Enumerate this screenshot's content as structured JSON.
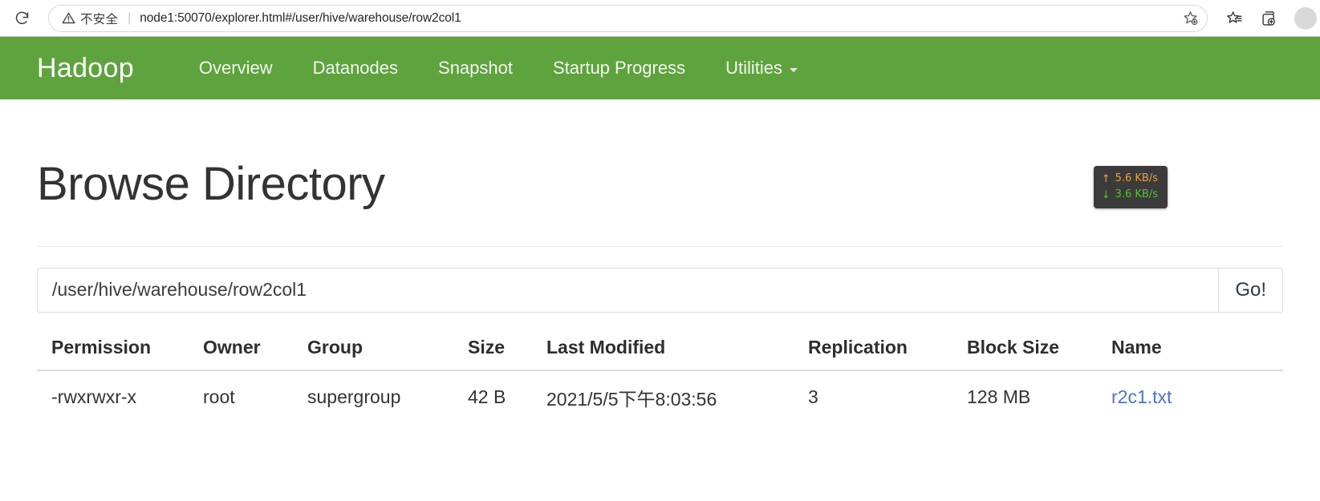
{
  "browser": {
    "reload_icon": "reload-icon",
    "security_warning": "不安全",
    "separator": "|",
    "url": "node1:50070/explorer.html#/user/hive/warehouse/row2col1",
    "favorite_icon": "add-favorite-icon",
    "collections_icon": "favorites-list-icon",
    "tab_collections_icon": "add-collection-icon",
    "profile_icon": "profile-avatar"
  },
  "navbar": {
    "brand": "Hadoop",
    "items": [
      {
        "label": "Overview",
        "dropdown": false
      },
      {
        "label": "Datanodes",
        "dropdown": false
      },
      {
        "label": "Snapshot",
        "dropdown": false
      },
      {
        "label": "Startup Progress",
        "dropdown": false
      },
      {
        "label": "Utilities",
        "dropdown": true
      }
    ],
    "background": "#5fa33f"
  },
  "page": {
    "title": "Browse Directory"
  },
  "net_speed": {
    "upload": "5.6 KB/s",
    "download": "3.6 KB/s",
    "up_arrow": "↑",
    "down_arrow": "↓",
    "up_color": "#e8a33d",
    "down_color": "#57c22d",
    "background": "#3b3b3b"
  },
  "path_form": {
    "value": "/user/hive/warehouse/row2col1",
    "placeholder": "/user/hive/warehouse/row2col1",
    "go_label": "Go!"
  },
  "table": {
    "headers": [
      "Permission",
      "Owner",
      "Group",
      "Size",
      "Last Modified",
      "Replication",
      "Block Size",
      "Name"
    ],
    "rows": [
      {
        "permission": "-rwxrwxr-x",
        "owner": "root",
        "group": "supergroup",
        "size": "42 B",
        "last_modified": "2021/5/5下午8:03:56",
        "replication": "3",
        "block_size": "128 MB",
        "name": "r2c1.txt",
        "name_color": "#4a74c9"
      }
    ]
  }
}
